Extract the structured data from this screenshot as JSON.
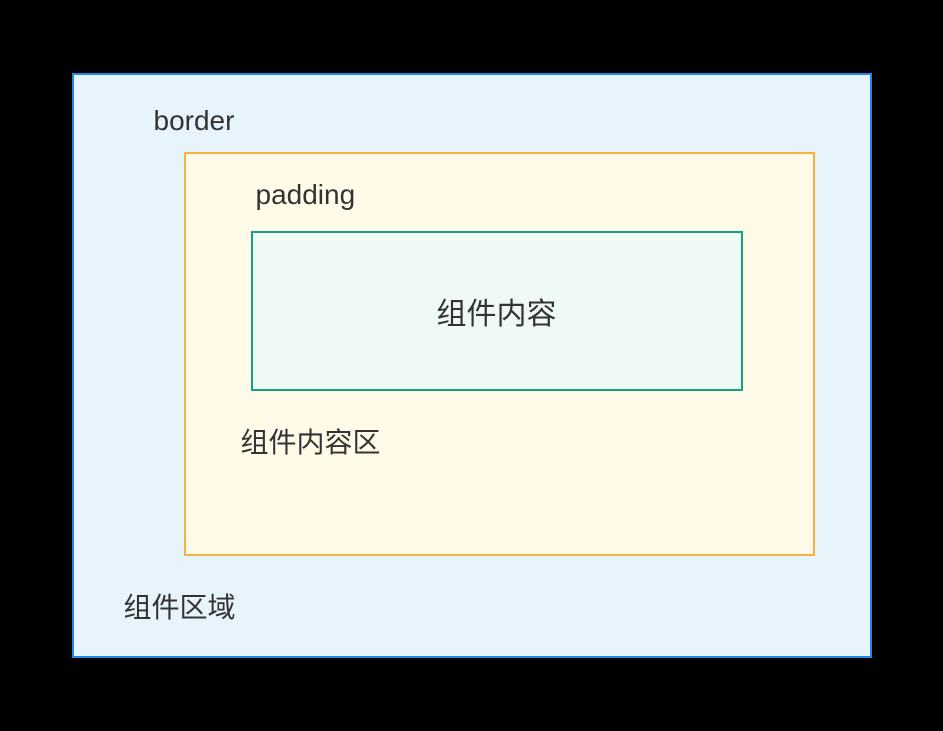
{
  "diagram": {
    "outer": {
      "topLabel": "border",
      "bottomLabel": "组件区域",
      "bgColor": "#e8f4fc",
      "borderColor": "#1e88e5"
    },
    "middle": {
      "topLabel": "padding",
      "bottomLabel": "组件内容区",
      "bgColor": "#fffbe8",
      "borderColor": "#f5b041"
    },
    "inner": {
      "label": "组件内容",
      "bgColor": "#f0faf5",
      "borderColor": "#16a085"
    }
  }
}
